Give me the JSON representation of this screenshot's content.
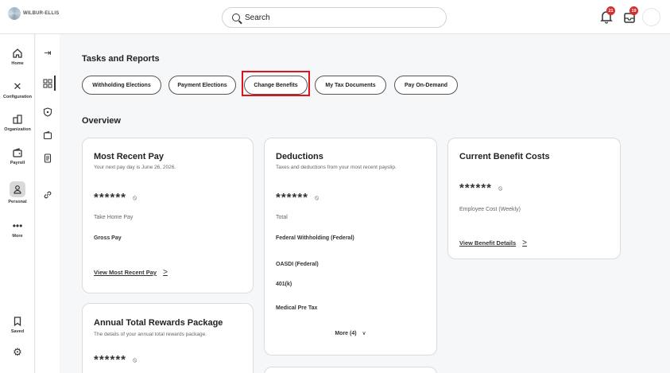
{
  "brand": {
    "name": "WILBUR-ELLIS"
  },
  "search": {
    "placeholder": "Search"
  },
  "notifications": {
    "bell_count": "21",
    "inbox_count": "19"
  },
  "left_nav": {
    "items": [
      {
        "label": "Home",
        "icon": "home-icon"
      },
      {
        "label": "Configuration",
        "icon": "tools-icon"
      },
      {
        "label": "Organization",
        "icon": "org-icon"
      },
      {
        "label": "Payroll",
        "icon": "wallet-icon"
      },
      {
        "label": "Personal",
        "icon": "person-icon"
      },
      {
        "label": "More",
        "icon": "more-icon"
      }
    ],
    "saved": {
      "label": "Saved",
      "icon": "bookmark-icon"
    },
    "settings_icon": "gear-icon"
  },
  "tasks": {
    "heading": "Tasks and Reports",
    "buttons": [
      "Withholding Elections",
      "Payment Elections",
      "Change Benefits",
      "My Tax Documents",
      "Pay On-Demand"
    ],
    "highlighted": "Change Benefits"
  },
  "overview": {
    "heading": "Overview"
  },
  "cards": {
    "recent_pay": {
      "title": "Most Recent Pay",
      "subtitle": "Your next pay day is June 26, 2026.",
      "masked": "******",
      "take_home": "Take Home Pay",
      "gross": "Gross Pay",
      "link": "View Most Recent Pay",
      "chevron": ">"
    },
    "deductions": {
      "title": "Deductions",
      "subtitle": "Taxes and deductions from your most recent payslip.",
      "masked": "******",
      "total": "Total",
      "items": [
        "Federal Withholding (Federal)",
        "OASDI (Federal)",
        "401(k)",
        "Medical Pre Tax"
      ],
      "more": "More (4)",
      "more_chevron": "∨"
    },
    "benefit_costs": {
      "title": "Current Benefit Costs",
      "masked": "******",
      "label": "Employee Cost (Weekly)",
      "link": "View Benefit Details",
      "chevron": ">"
    },
    "rewards": {
      "title": "Annual Total Rewards Package",
      "subtitle": "The details of your annual total rewards package.",
      "masked": "******"
    }
  },
  "colors": {
    "highlight": "#e0141b",
    "badge": "#d32f2f",
    "background": "#f6f7f8"
  }
}
